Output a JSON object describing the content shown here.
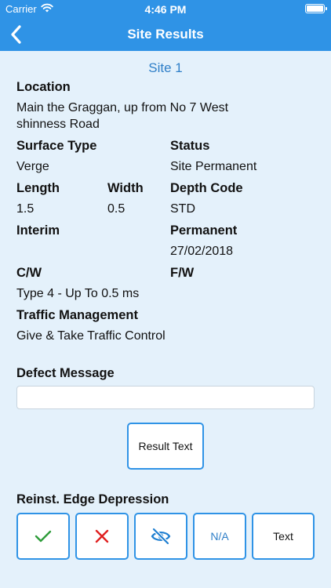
{
  "status_bar": {
    "carrier": "Carrier",
    "time": "4:46 PM"
  },
  "nav": {
    "title": "Site Results"
  },
  "site": {
    "name": "Site 1",
    "location_label": "Location",
    "location_line1": "Main the Graggan, up from No 7 West",
    "location_line2": "shinness Road",
    "surface_type_label": "Surface Type",
    "surface_type_value": "Verge",
    "status_label": "Status",
    "status_value": "Site Permanent",
    "length_label": "Length",
    "length_value": "1.5",
    "width_label": "Width",
    "width_value": "0.5",
    "depth_code_label": "Depth Code",
    "depth_code_value": "STD",
    "interim_label": "Interim",
    "permanent_label": "Permanent",
    "permanent_value": "27/02/2018",
    "cw_label": "C/W",
    "cw_value": "Type 4 - Up To 0.5 ms",
    "fw_label": "F/W",
    "traffic_label": "Traffic Management",
    "traffic_value": "Give & Take Traffic Control"
  },
  "defect": {
    "label": "Defect Message",
    "value": ""
  },
  "result_button": "Result Text",
  "reinst": {
    "label": "Reinst. Edge Depression",
    "na_label": "N/A",
    "text_label": "Text"
  },
  "colors": {
    "accent": "#2f93e6",
    "background": "#e4f1fb",
    "check": "#2e9c3a",
    "cross": "#e02020",
    "link": "#2f7fc8"
  },
  "icons": [
    "chevron-left-icon",
    "wifi-icon",
    "battery-icon",
    "check-icon",
    "cross-icon",
    "eye-slash-icon"
  ]
}
